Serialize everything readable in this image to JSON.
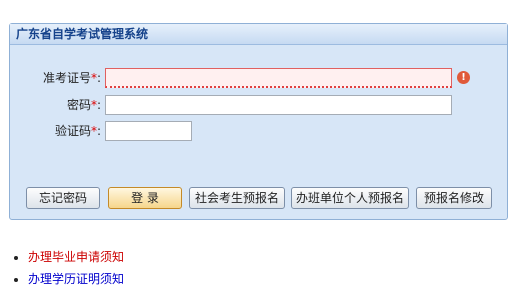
{
  "panel": {
    "title": "广东省自学考试管理系统"
  },
  "form": {
    "exam_id": {
      "label": "准考证号",
      "required_mark": "*",
      "colon": ":",
      "value": ""
    },
    "password": {
      "label": "密码",
      "required_mark": "*",
      "colon": ":",
      "value": ""
    },
    "captcha": {
      "label": "验证码",
      "required_mark": "*",
      "colon": ":",
      "value": ""
    }
  },
  "buttons": {
    "forgot": "忘记密码",
    "login": "登 录",
    "social_prereg": "社会考生预报名",
    "org_prereg": "办班单位个人预报名",
    "prereg_modify": "预报名修改"
  },
  "links": [
    {
      "text": "办理毕业申请须知",
      "color": "#cc0000"
    },
    {
      "text": "办理学历证明须知",
      "color": "#0000cc"
    }
  ],
  "colors": {
    "panel_bg": "#d7e6f7",
    "header_text": "#15428b",
    "required": "#dd0000"
  },
  "icons": {
    "error": "error-icon"
  }
}
